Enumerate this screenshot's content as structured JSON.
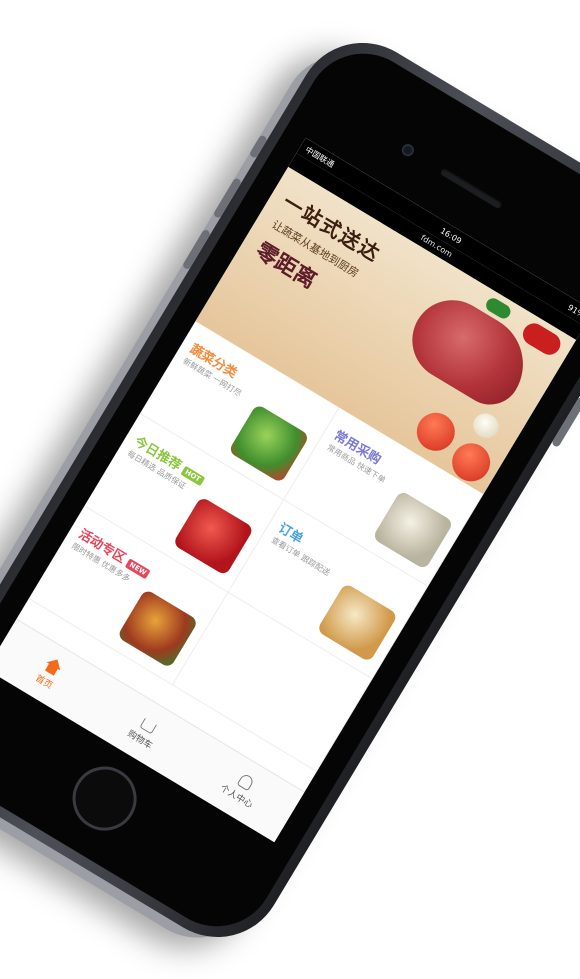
{
  "status": {
    "carrier": "中国联通",
    "time": "16:09",
    "battery": "91%"
  },
  "browser": {
    "url": "fdm.com"
  },
  "hero": {
    "title": "一站式送达",
    "subtitle": "让蔬菜从基地到厨房",
    "slogan": "零距离"
  },
  "grid": [
    {
      "title": "蔬菜分类",
      "desc": "新鲜蔬菜 一网打尽",
      "badge": "",
      "color": "#f28b3c"
    },
    {
      "title": "常用采购",
      "desc": "常用商品 快速下单",
      "badge": "",
      "color": "#7a7ad6"
    },
    {
      "title": "今日推荐",
      "desc": "每日精选 品质保证",
      "badge": "HOT",
      "color": "#8cc63f"
    },
    {
      "title": "订单",
      "desc": "查看订单 跟踪配送",
      "badge": "",
      "color": "#4aa3df"
    },
    {
      "title": "活动专区",
      "desc": "限时特惠 优惠多多",
      "badge": "NEW",
      "color": "#e8455b"
    },
    {
      "title": "",
      "desc": "",
      "badge": "",
      "color": "#ffffff"
    }
  ],
  "tabs": [
    {
      "label": "首页",
      "icon": "home-icon",
      "active": true
    },
    {
      "label": "购物车",
      "icon": "cart-icon",
      "active": false
    },
    {
      "label": "个人中心",
      "icon": "user-icon",
      "active": false
    }
  ],
  "colors": {
    "accent": "#f26a1b",
    "phone": "#3b3d43"
  }
}
